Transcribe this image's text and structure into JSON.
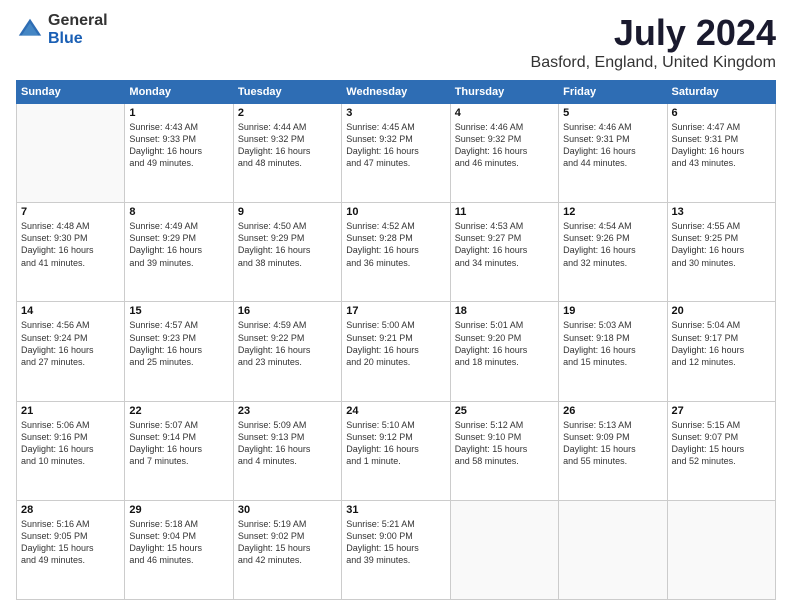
{
  "header": {
    "logo_general": "General",
    "logo_blue": "Blue",
    "title": "July 2024",
    "subtitle": "Basford, England, United Kingdom"
  },
  "weekdays": [
    "Sunday",
    "Monday",
    "Tuesday",
    "Wednesday",
    "Thursday",
    "Friday",
    "Saturday"
  ],
  "weeks": [
    [
      {
        "day": "",
        "info": ""
      },
      {
        "day": "1",
        "info": "Sunrise: 4:43 AM\nSunset: 9:33 PM\nDaylight: 16 hours\nand 49 minutes."
      },
      {
        "day": "2",
        "info": "Sunrise: 4:44 AM\nSunset: 9:32 PM\nDaylight: 16 hours\nand 48 minutes."
      },
      {
        "day": "3",
        "info": "Sunrise: 4:45 AM\nSunset: 9:32 PM\nDaylight: 16 hours\nand 47 minutes."
      },
      {
        "day": "4",
        "info": "Sunrise: 4:46 AM\nSunset: 9:32 PM\nDaylight: 16 hours\nand 46 minutes."
      },
      {
        "day": "5",
        "info": "Sunrise: 4:46 AM\nSunset: 9:31 PM\nDaylight: 16 hours\nand 44 minutes."
      },
      {
        "day": "6",
        "info": "Sunrise: 4:47 AM\nSunset: 9:31 PM\nDaylight: 16 hours\nand 43 minutes."
      }
    ],
    [
      {
        "day": "7",
        "info": "Sunrise: 4:48 AM\nSunset: 9:30 PM\nDaylight: 16 hours\nand 41 minutes."
      },
      {
        "day": "8",
        "info": "Sunrise: 4:49 AM\nSunset: 9:29 PM\nDaylight: 16 hours\nand 39 minutes."
      },
      {
        "day": "9",
        "info": "Sunrise: 4:50 AM\nSunset: 9:29 PM\nDaylight: 16 hours\nand 38 minutes."
      },
      {
        "day": "10",
        "info": "Sunrise: 4:52 AM\nSunset: 9:28 PM\nDaylight: 16 hours\nand 36 minutes."
      },
      {
        "day": "11",
        "info": "Sunrise: 4:53 AM\nSunset: 9:27 PM\nDaylight: 16 hours\nand 34 minutes."
      },
      {
        "day": "12",
        "info": "Sunrise: 4:54 AM\nSunset: 9:26 PM\nDaylight: 16 hours\nand 32 minutes."
      },
      {
        "day": "13",
        "info": "Sunrise: 4:55 AM\nSunset: 9:25 PM\nDaylight: 16 hours\nand 30 minutes."
      }
    ],
    [
      {
        "day": "14",
        "info": "Sunrise: 4:56 AM\nSunset: 9:24 PM\nDaylight: 16 hours\nand 27 minutes."
      },
      {
        "day": "15",
        "info": "Sunrise: 4:57 AM\nSunset: 9:23 PM\nDaylight: 16 hours\nand 25 minutes."
      },
      {
        "day": "16",
        "info": "Sunrise: 4:59 AM\nSunset: 9:22 PM\nDaylight: 16 hours\nand 23 minutes."
      },
      {
        "day": "17",
        "info": "Sunrise: 5:00 AM\nSunset: 9:21 PM\nDaylight: 16 hours\nand 20 minutes."
      },
      {
        "day": "18",
        "info": "Sunrise: 5:01 AM\nSunset: 9:20 PM\nDaylight: 16 hours\nand 18 minutes."
      },
      {
        "day": "19",
        "info": "Sunrise: 5:03 AM\nSunset: 9:18 PM\nDaylight: 16 hours\nand 15 minutes."
      },
      {
        "day": "20",
        "info": "Sunrise: 5:04 AM\nSunset: 9:17 PM\nDaylight: 16 hours\nand 12 minutes."
      }
    ],
    [
      {
        "day": "21",
        "info": "Sunrise: 5:06 AM\nSunset: 9:16 PM\nDaylight: 16 hours\nand 10 minutes."
      },
      {
        "day": "22",
        "info": "Sunrise: 5:07 AM\nSunset: 9:14 PM\nDaylight: 16 hours\nand 7 minutes."
      },
      {
        "day": "23",
        "info": "Sunrise: 5:09 AM\nSunset: 9:13 PM\nDaylight: 16 hours\nand 4 minutes."
      },
      {
        "day": "24",
        "info": "Sunrise: 5:10 AM\nSunset: 9:12 PM\nDaylight: 16 hours\nand 1 minute."
      },
      {
        "day": "25",
        "info": "Sunrise: 5:12 AM\nSunset: 9:10 PM\nDaylight: 15 hours\nand 58 minutes."
      },
      {
        "day": "26",
        "info": "Sunrise: 5:13 AM\nSunset: 9:09 PM\nDaylight: 15 hours\nand 55 minutes."
      },
      {
        "day": "27",
        "info": "Sunrise: 5:15 AM\nSunset: 9:07 PM\nDaylight: 15 hours\nand 52 minutes."
      }
    ],
    [
      {
        "day": "28",
        "info": "Sunrise: 5:16 AM\nSunset: 9:05 PM\nDaylight: 15 hours\nand 49 minutes."
      },
      {
        "day": "29",
        "info": "Sunrise: 5:18 AM\nSunset: 9:04 PM\nDaylight: 15 hours\nand 46 minutes."
      },
      {
        "day": "30",
        "info": "Sunrise: 5:19 AM\nSunset: 9:02 PM\nDaylight: 15 hours\nand 42 minutes."
      },
      {
        "day": "31",
        "info": "Sunrise: 5:21 AM\nSunset: 9:00 PM\nDaylight: 15 hours\nand 39 minutes."
      },
      {
        "day": "",
        "info": ""
      },
      {
        "day": "",
        "info": ""
      },
      {
        "day": "",
        "info": ""
      }
    ]
  ]
}
